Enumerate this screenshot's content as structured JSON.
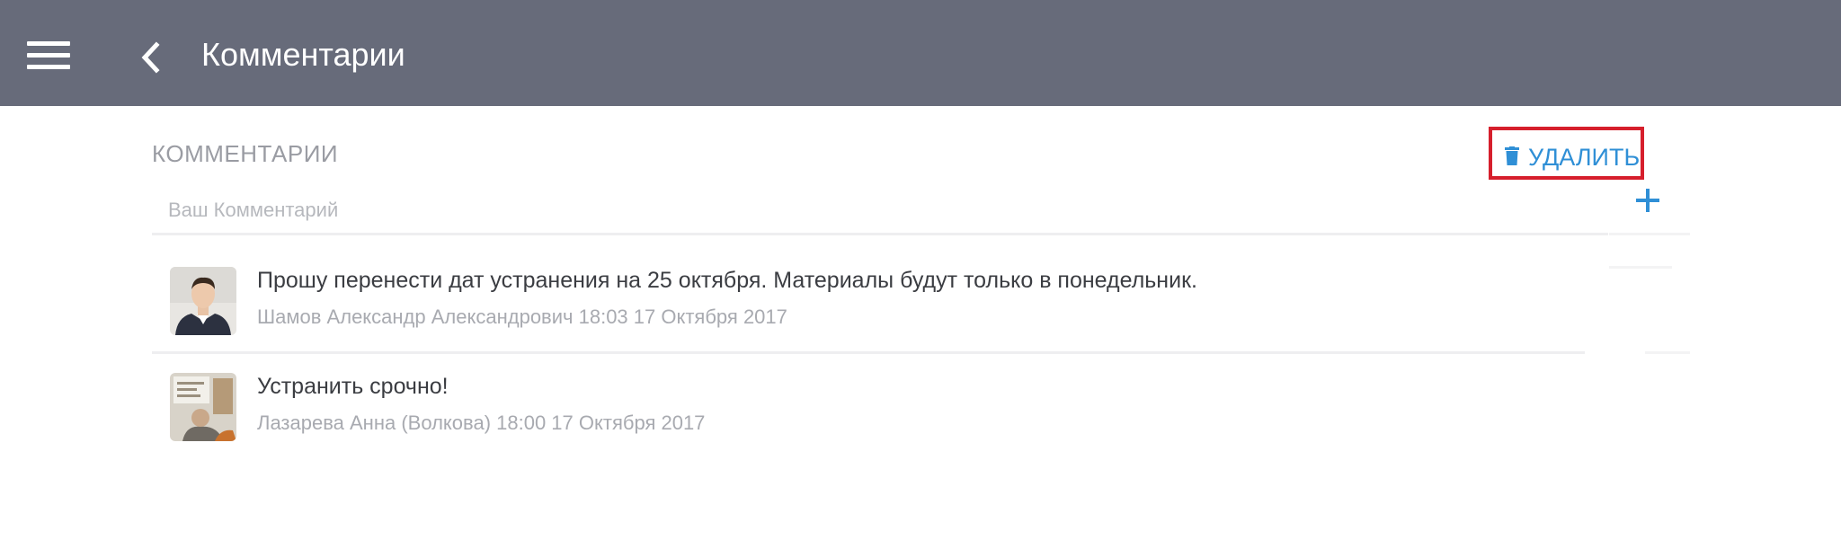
{
  "header": {
    "title": "Комментарии",
    "menu_icon": "hamburger-menu-icon",
    "back_icon": "chevron-left-icon",
    "background_color": "#676b7a"
  },
  "comments_section": {
    "label": "КОММЕНТАРИИ",
    "delete_button": {
      "label": "УДАЛИТЬ",
      "icon": "trash-icon",
      "color": "#2f8fd6",
      "highlight_color": "#d61f2c"
    },
    "input": {
      "placeholder": "Ваш Комментарий",
      "value": ""
    },
    "add_button_icon": "plus-icon",
    "items": [
      {
        "text": "Прошу перенести дат устранения на 25 октября. Материалы будут только в понедельник.",
        "meta": "Шамов Александр Александрович 18:03 17 Октября 2017",
        "avatar": "avatar-man-in-suit"
      },
      {
        "text": "Устранить срочно!",
        "meta": "Лазарева Анна (Волкова) 18:00 17 Октября 2017",
        "avatar": "avatar-group-photo"
      }
    ]
  }
}
